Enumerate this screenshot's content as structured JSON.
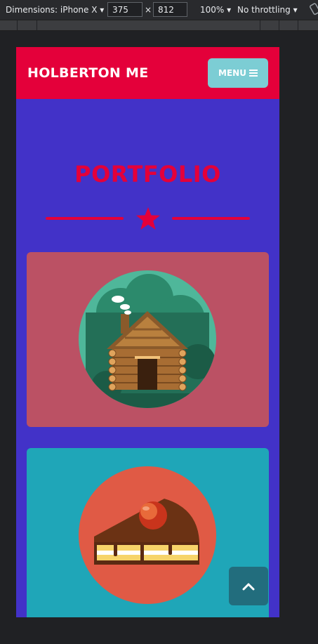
{
  "devtools": {
    "device_label": "Dimensions: iPhone X ▾",
    "width_value": "375",
    "times_sign": "×",
    "height_value": "812",
    "zoom_label": "100% ▾",
    "throttle_label": "No throttling ▾"
  },
  "header": {
    "brand": "HOLBERTON ME",
    "menu_label": "MENU"
  },
  "portfolio": {
    "title": "PORTFOLIO"
  },
  "cards": [
    {
      "name": "cabin",
      "color": "#bb5164"
    },
    {
      "name": "cake",
      "color": "#1fa6b8"
    }
  ],
  "colors": {
    "primary_red": "#e4003a",
    "page_background": "#4232c8",
    "menu_button": "#7ccdd4",
    "top_button": "#226d7d"
  },
  "icons": [
    "bars-icon",
    "star-icon",
    "chevron-up-icon",
    "rotate-icon"
  ]
}
